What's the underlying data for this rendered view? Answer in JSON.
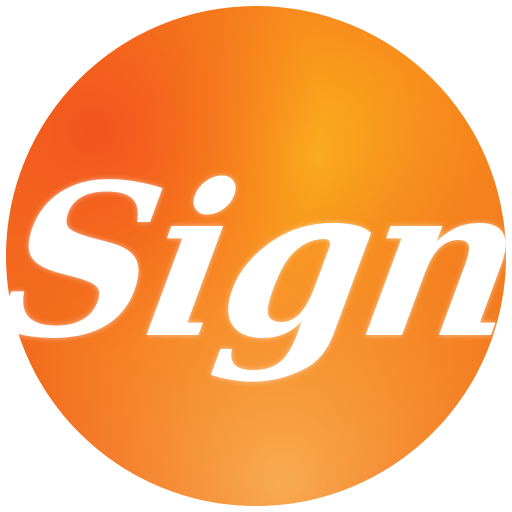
{
  "icon": {
    "label": "Sign",
    "semantic_name": "sign-app-icon",
    "colors": {
      "warm_red": "#f2501e",
      "orange": "#f7861c",
      "amber": "#fbae1d",
      "light_orange": "#f9a545",
      "text": "#ffffff"
    }
  }
}
